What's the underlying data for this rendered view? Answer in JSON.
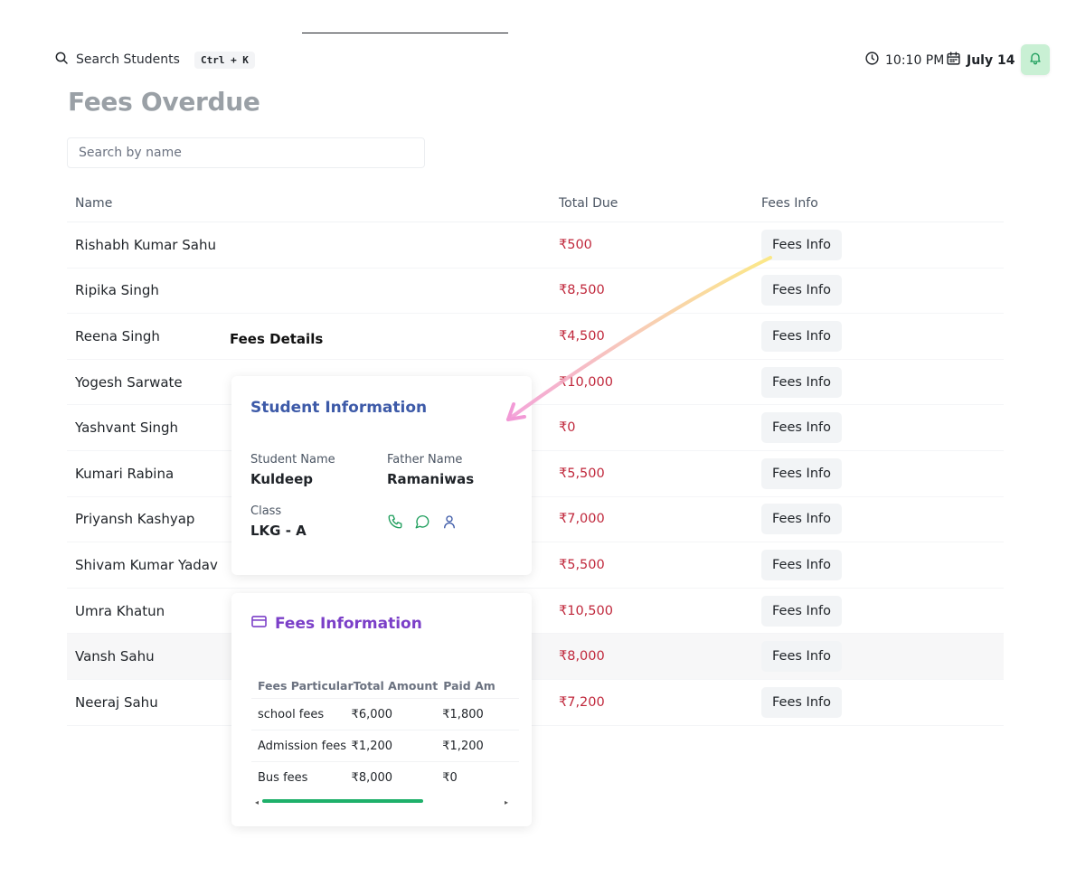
{
  "topbar": {
    "search_label": "Search Students",
    "shortcut": "Ctrl + K",
    "time": "10:10 PM",
    "date": "July 14"
  },
  "page": {
    "title": "Fees Overdue",
    "search_placeholder": "Search by name"
  },
  "table": {
    "headers": {
      "name": "Name",
      "total_due": "Total Due",
      "fees_info": "Fees Info"
    },
    "rows": [
      {
        "name": "Rishabh Kumar Sahu",
        "due": "₹500",
        "action": "Fees Info"
      },
      {
        "name": "Ripika Singh",
        "due": "₹8,500",
        "action": "Fees Info"
      },
      {
        "name": "Reena Singh",
        "due": "₹4,500",
        "action": "Fees Info"
      },
      {
        "name": "Yogesh Sarwate",
        "due": "₹10,000",
        "action": "Fees Info"
      },
      {
        "name": "Yashvant Singh",
        "due": "₹0",
        "action": "Fees Info"
      },
      {
        "name": "Kumari Rabina",
        "due": "₹5,500",
        "action": "Fees Info"
      },
      {
        "name": "Priyansh Kashyap",
        "due": "₹7,000",
        "action": "Fees Info"
      },
      {
        "name": "Shivam Kumar Yadav",
        "due": "₹5,500",
        "action": "Fees Info"
      },
      {
        "name": "Umra Khatun",
        "due": "₹10,500",
        "action": "Fees Info"
      },
      {
        "name": "Vansh Sahu",
        "due": "₹8,000",
        "action": "Fees Info"
      },
      {
        "name": "Neeraj Sahu",
        "due": "₹7,200",
        "action": "Fees Info"
      }
    ]
  },
  "fees_details": {
    "title": "Fees Details",
    "student_info": {
      "heading": "Student Information",
      "student_name_label": "Student Name",
      "student_name": "Kuldeep",
      "father_name_label": "Father Name",
      "father_name": "Ramaniwas",
      "class_label": "Class",
      "class_value": "LKG - A"
    },
    "fees_info": {
      "heading": "Fees Information",
      "columns": [
        "Fees Particular",
        "Total Amount",
        "Paid Am"
      ],
      "rows": [
        {
          "particular": "school fees",
          "total": "₹6,000",
          "paid": "₹1,800"
        },
        {
          "particular": "Admission fees",
          "total": "₹1,200",
          "paid": "₹1,200"
        },
        {
          "particular": "Bus fees",
          "total": "₹8,000",
          "paid": "₹0"
        }
      ]
    }
  },
  "colors": {
    "due_red": "#c0283c",
    "student_heading_blue": "#3d5aa8",
    "fees_heading_purple": "#7b3fc8",
    "bell_green_bg": "#c9f0d4",
    "contact_green": "#1e9e5c",
    "scroll_green": "#1eb06a"
  },
  "icons": {
    "search": "search-icon",
    "clock": "clock-icon",
    "calendar": "calendar-icon",
    "bell": "bell-icon",
    "phone": "phone-icon",
    "chat": "chat-icon",
    "user": "user-icon",
    "card": "credit-card-icon"
  }
}
